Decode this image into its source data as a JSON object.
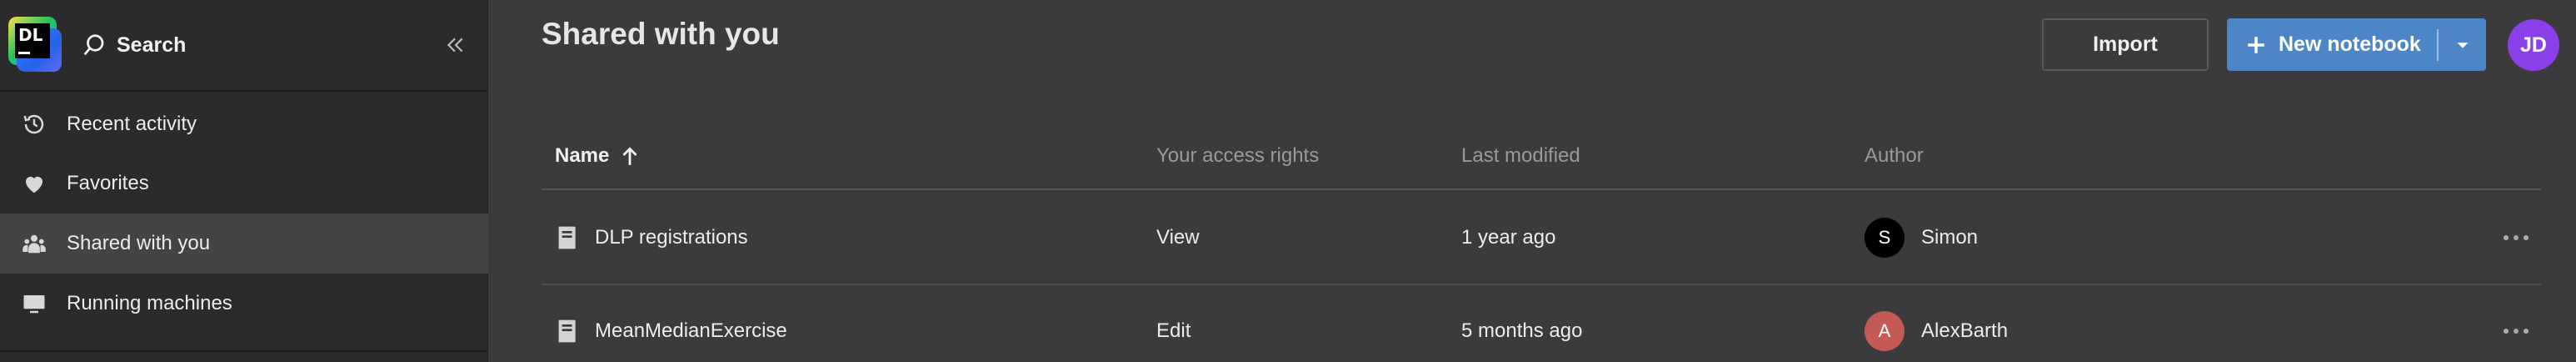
{
  "sidebar": {
    "logo_text": "DL",
    "search_label": "Search",
    "items": [
      {
        "label": "Recent activity",
        "icon": "history-icon",
        "active": false
      },
      {
        "label": "Favorites",
        "icon": "heart-icon",
        "active": false
      },
      {
        "label": "Shared with you",
        "icon": "people-icon",
        "active": true
      },
      {
        "label": "Running machines",
        "icon": "monitor-icon",
        "active": false
      }
    ]
  },
  "header": {
    "title": "Shared with you",
    "import_label": "Import",
    "new_notebook_label": "New notebook",
    "avatar_initials": "JD"
  },
  "table": {
    "columns": {
      "name": "Name",
      "access": "Your access rights",
      "modified": "Last modified",
      "author": "Author"
    },
    "sort": {
      "column": "name",
      "direction": "ascending"
    },
    "rows": [
      {
        "name": "DLP registrations",
        "access": "View",
        "modified": "1 year ago",
        "author": "Simon",
        "author_initial": "S",
        "author_color": "#000000"
      },
      {
        "name": "MeanMedianExercise",
        "access": "Edit",
        "modified": "5 months ago",
        "author": "AlexBarth",
        "author_initial": "A",
        "author_color": "#c45a55"
      }
    ]
  },
  "colors": {
    "accent": "#4d86c6",
    "avatar": "#8b3fe8",
    "background": "#3b3b3d",
    "sidebar": "#2b2b2d"
  }
}
